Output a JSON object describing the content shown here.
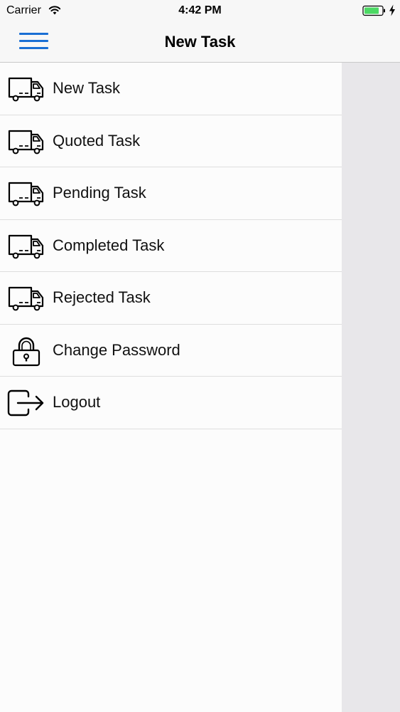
{
  "status_bar": {
    "carrier": "Carrier",
    "time": "4:42 PM",
    "battery_color": "#4cd964"
  },
  "nav_bar": {
    "title": "New Task",
    "menu_icon": "hamburger-menu-icon",
    "accent_color": "#1a6fd4"
  },
  "drawer": {
    "items": [
      {
        "label": "New Task",
        "icon": "truck-icon"
      },
      {
        "label": "Quoted Task",
        "icon": "truck-icon"
      },
      {
        "label": "Pending Task",
        "icon": "truck-icon"
      },
      {
        "label": "Completed Task",
        "icon": "truck-icon"
      },
      {
        "label": "Rejected Task",
        "icon": "truck-icon"
      },
      {
        "label": "Change Password",
        "icon": "lock-icon"
      },
      {
        "label": "Logout",
        "icon": "logout-icon"
      }
    ]
  }
}
